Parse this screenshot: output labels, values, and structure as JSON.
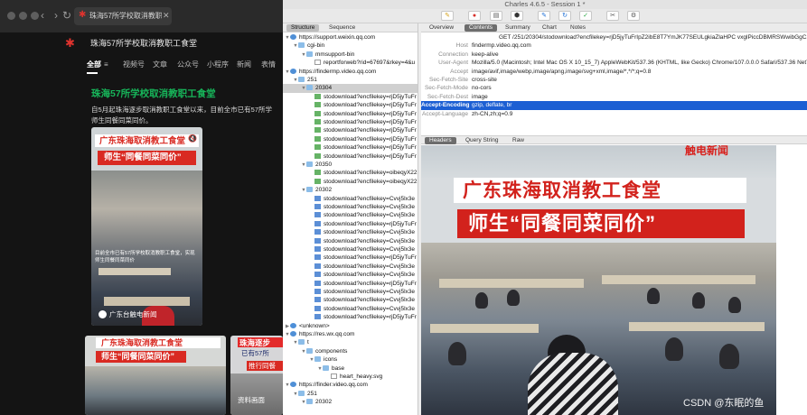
{
  "browser": {
    "tab_title": "珠海57所学校取消教职工食堂",
    "tab_close": "✕",
    "nav": {
      "back": "‹",
      "forward": "›",
      "reload": "↻"
    },
    "page_title": "珠海57所学校取消教职工食堂",
    "filters": [
      "全部",
      "视频号",
      "文章",
      "公众号",
      "小程序",
      "新闻",
      "表情"
    ],
    "filter_menu_icon": "≡",
    "article": {
      "title": "珠海57所学校取消教职工食堂",
      "body_line1": "自5月起珠海逐步取消教职工食堂以来，目前全市已有57所学",
      "body_line2": "师生同餐同菜同价。"
    },
    "video_main": {
      "banner1": "广东珠海取消教工食堂",
      "banner2": "师生“同餐同菜同价”",
      "subtitle": "目前全市已有57所学校取消教职工食堂，实现师生同餐同菜同价",
      "footer": "广东台触电新闻",
      "mute_icon": "🔇"
    },
    "video_b": {
      "banner1": "广东珠海取消教工食堂",
      "banner2": "师生“同餐同菜同价”"
    },
    "video_c": {
      "banner1": "珠海逐步",
      "line2": "已有57所",
      "line3": "推行同餐",
      "caption": "资料画面"
    }
  },
  "charles": {
    "title": "Charles 4.6.5 - Session 1 *",
    "left_tabs": [
      "Structure",
      "Sequence"
    ],
    "right_tabs": [
      "Overview",
      "Contents",
      "Summary",
      "Chart",
      "Notes"
    ],
    "bottom_tabs": [
      "Headers",
      "Query String",
      "Raw"
    ],
    "tree": [
      {
        "level": 0,
        "twisty": "▼",
        "icon": "globe",
        "label": "https://support.weixin.qq.com"
      },
      {
        "level": 1,
        "twisty": "▼",
        "icon": "folder",
        "label": "cgi-bin"
      },
      {
        "level": 2,
        "twisty": "▼",
        "icon": "folder",
        "label": "mmsupport-bin"
      },
      {
        "level": 3,
        "twisty": "",
        "icon": "doc",
        "label": "reportforweb?rid=67697&rkey=4&u"
      },
      {
        "level": 0,
        "twisty": "▼",
        "icon": "globe",
        "label": "https://findermp.video.qq.com"
      },
      {
        "level": 1,
        "twisty": "▼",
        "icon": "folder",
        "label": "251"
      },
      {
        "level": 2,
        "twisty": "▼",
        "icon": "folder",
        "label": "20304",
        "selected": true
      },
      {
        "level": 3,
        "twisty": "",
        "icon": "img",
        "label": "stodownload?encfilekey=rjD5jyTuFr"
      },
      {
        "level": 3,
        "twisty": "",
        "icon": "img",
        "label": "stodownload?encfilekey=rjD5jyTuFr"
      },
      {
        "level": 3,
        "twisty": "",
        "icon": "img",
        "label": "stodownload?encfilekey=rjD5jyTuFr"
      },
      {
        "level": 3,
        "twisty": "",
        "icon": "img",
        "label": "stodownload?encfilekey=rjD5jyTuFr"
      },
      {
        "level": 3,
        "twisty": "",
        "icon": "img",
        "label": "stodownload?encfilekey=rjD5jyTuFr"
      },
      {
        "level": 3,
        "twisty": "",
        "icon": "img",
        "label": "stodownload?encfilekey=rjD5jyTuFr"
      },
      {
        "level": 3,
        "twisty": "",
        "icon": "img",
        "label": "stodownload?encfilekey=rjD5jyTuFr"
      },
      {
        "level": 3,
        "twisty": "",
        "icon": "img",
        "label": "stodownload?encfilekey=rjD5jyTuFr"
      },
      {
        "level": 2,
        "twisty": "▼",
        "icon": "folder",
        "label": "20350"
      },
      {
        "level": 3,
        "twisty": "",
        "icon": "img",
        "label": "stodownload?encfilekey=oibeqyX22"
      },
      {
        "level": 3,
        "twisty": "",
        "icon": "img",
        "label": "stodownload?encfilekey=oibeqyX22"
      },
      {
        "level": 2,
        "twisty": "▼",
        "icon": "folder",
        "label": "20302"
      },
      {
        "level": 3,
        "twisty": "",
        "icon": "file",
        "label": "stodownload?encfilekey=Cvvj5lx3e"
      },
      {
        "level": 3,
        "twisty": "",
        "icon": "file",
        "label": "stodownload?encfilekey=Cvvj5lx3e"
      },
      {
        "level": 3,
        "twisty": "",
        "icon": "file",
        "label": "stodownload?encfilekey=Cvvj5lx3e"
      },
      {
        "level": 3,
        "twisty": "",
        "icon": "file",
        "label": "stodownload?encfilekey=rjD5jyTuFr"
      },
      {
        "level": 3,
        "twisty": "",
        "icon": "file",
        "label": "stodownload?encfilekey=Cvvj5lx3e"
      },
      {
        "level": 3,
        "twisty": "",
        "icon": "file",
        "label": "stodownload?encfilekey=Cvvj5lx3e"
      },
      {
        "level": 3,
        "twisty": "",
        "icon": "file",
        "label": "stodownload?encfilekey=Cvvj5lx3e"
      },
      {
        "level": 3,
        "twisty": "",
        "icon": "file",
        "label": "stodownload?encfilekey=rjD5jyTuFr"
      },
      {
        "level": 3,
        "twisty": "",
        "icon": "file",
        "label": "stodownload?encfilekey=Cvvj5lx3e"
      },
      {
        "level": 3,
        "twisty": "",
        "icon": "file",
        "label": "stodownload?encfilekey=Cvvj5lx3e"
      },
      {
        "level": 3,
        "twisty": "",
        "icon": "file",
        "label": "stodownload?encfilekey=rjD5jyTuFr"
      },
      {
        "level": 3,
        "twisty": "",
        "icon": "file",
        "label": "stodownload?encfilekey=Cvvj5lx3e"
      },
      {
        "level": 3,
        "twisty": "",
        "icon": "file",
        "label": "stodownload?encfilekey=Cvvj5lx3e"
      },
      {
        "level": 3,
        "twisty": "",
        "icon": "file",
        "label": "stodownload?encfilekey=Cvvj5lx3e"
      },
      {
        "level": 3,
        "twisty": "",
        "icon": "file",
        "label": "stodownload?encfilekey=rjD5jyTuFr"
      },
      {
        "level": 0,
        "twisty": "▶",
        "icon": "unk",
        "label": "<unknown>"
      },
      {
        "level": 0,
        "twisty": "▼",
        "icon": "globe",
        "label": "https://res.wx.qq.com"
      },
      {
        "level": 1,
        "twisty": "▼",
        "icon": "folder",
        "label": "t"
      },
      {
        "level": 2,
        "twisty": "▼",
        "icon": "folder",
        "label": "components"
      },
      {
        "level": 3,
        "twisty": "▼",
        "icon": "folder",
        "label": "icons"
      },
      {
        "level": 4,
        "twisty": "▼",
        "icon": "folder",
        "label": "base"
      },
      {
        "level": 5,
        "twisty": "",
        "icon": "doc",
        "label": "heart_heavy.svg"
      },
      {
        "level": 0,
        "twisty": "▼",
        "icon": "globe",
        "label": "https://finder.video.qq.com"
      },
      {
        "level": 1,
        "twisty": "▼",
        "icon": "folder",
        "label": "251"
      },
      {
        "level": 2,
        "twisty": "▼",
        "icon": "folder",
        "label": "20302"
      }
    ],
    "request_line": "GET /251/20304/stodownload?encfilekey=rjD5jyTuFrIpZ2ibE8T7YmJK77SEULgkiaZlaHPC vxglPiccDBMRSWwibGgC2cMUibqU3cXt0",
    "headers": [
      {
        "key": "Host",
        "value": "findermp.video.qq.com"
      },
      {
        "key": "Connection",
        "value": "keep-alive"
      },
      {
        "key": "User-Agent",
        "value": "Mozilla/5.0 (Macintosh; Intel Mac OS X 10_15_7) AppleWebKit/537.36 (KHTML, like Gecko) Chrome/107.0.0.0 Safari/537.36 NetType/"
      },
      {
        "key": "Accept",
        "value": "image/avif,image/webp,image/apng,image/svg+xml,image/*,*/*;q=0.8"
      },
      {
        "key": "Sec-Fetch-Site",
        "value": "cross-site"
      },
      {
        "key": "Sec-Fetch-Mode",
        "value": "no-cors"
      },
      {
        "key": "Sec-Fetch-Dest",
        "value": "image"
      },
      {
        "key": "Accept-Encoding",
        "value": "gzip, deflate, br",
        "selected": true
      },
      {
        "key": "Accept-Language",
        "value": "zh-CN,zh;q=0.9"
      }
    ],
    "preview": {
      "logo": "触电新闻",
      "headline1": "广东珠海取消教工食堂",
      "headline2": "师生“同餐同菜同价”",
      "watermark": "CSDN @东眠的鱼"
    },
    "colors": {
      "selection": "#1c5fd3",
      "banner_red": "#d2221c",
      "accent_green": "#17b65a"
    }
  }
}
